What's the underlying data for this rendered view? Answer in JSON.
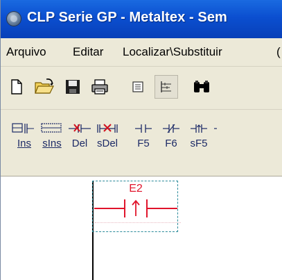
{
  "window": {
    "title": "CLP Serie GP - Metaltex - Sem",
    "icon": "globe-app-icon"
  },
  "menu": {
    "items": [
      {
        "label": "Arquivo"
      },
      {
        "label": "Editar"
      },
      {
        "label": "Localizar\\Substituir"
      }
    ]
  },
  "toolbar": {
    "buttons": [
      {
        "name": "new-file-icon"
      },
      {
        "name": "open-folder-icon"
      },
      {
        "name": "save-disk-icon"
      },
      {
        "name": "print-icon"
      },
      {
        "name": "list-view-icon"
      },
      {
        "name": "ladder-view-icon",
        "state": "pressed"
      },
      {
        "name": "binoculars-find-icon"
      }
    ]
  },
  "ladder_toolbar": {
    "buttons": [
      {
        "label": "Ins"
      },
      {
        "label": "sIns"
      },
      {
        "label": "Del"
      },
      {
        "label": "sDel"
      },
      {
        "label": "F5"
      },
      {
        "label": "F6"
      },
      {
        "label": "sF5"
      }
    ]
  },
  "ladder": {
    "contact_label": "E2",
    "contact_type": "rising-edge contact",
    "colors": {
      "contact": "#e0142b",
      "rail": "#000000",
      "selection": "#2a8a9a"
    }
  }
}
